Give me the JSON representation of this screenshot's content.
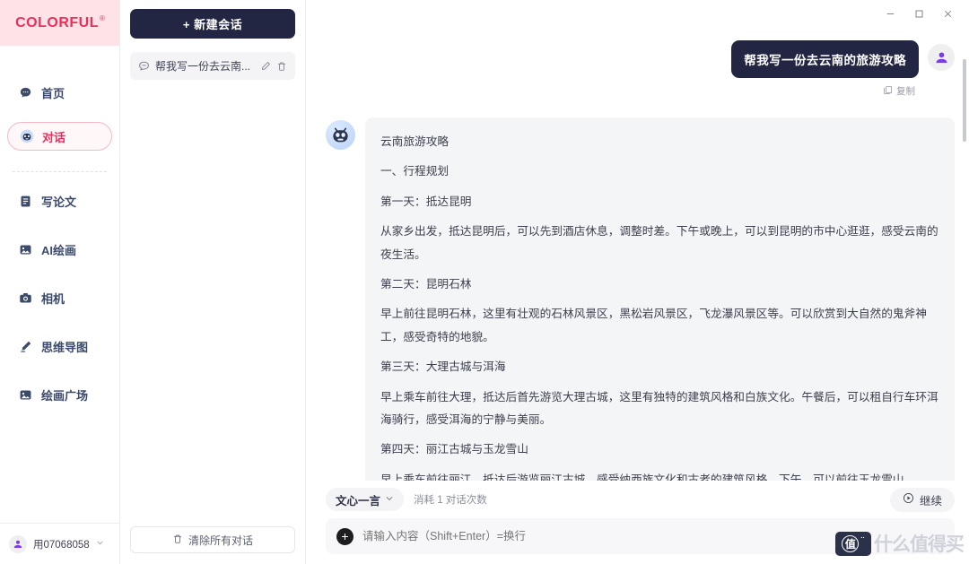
{
  "brand": {
    "name": "COLORFUL",
    "registered": "®"
  },
  "window_controls": {
    "minimize": "—",
    "maximize": "☐",
    "close": "✕"
  },
  "sidebar": {
    "primary_items": [
      {
        "label": "首页",
        "icon": "chat-bubble-icon",
        "active": false
      },
      {
        "label": "对话",
        "icon": "robot-icon",
        "active": true
      }
    ],
    "secondary_items": [
      {
        "label": "写论文",
        "icon": "document-icon"
      },
      {
        "label": "AI绘画",
        "icon": "image-icon"
      },
      {
        "label": "相机",
        "icon": "camera-icon"
      },
      {
        "label": "思维导图",
        "icon": "pen-icon"
      },
      {
        "label": "绘画广场",
        "icon": "gallery-icon"
      }
    ],
    "user": {
      "name": "用07068058",
      "icon": "user-avatar-icon",
      "chevron": "⌄"
    }
  },
  "conversations": {
    "new_chat_label": "+ 新建会话",
    "items": [
      {
        "title": "帮我写一份去云南...",
        "icon": "chat-icon",
        "edit_icon": "pencil-icon",
        "delete_icon": "trash-icon"
      }
    ],
    "clear_all_label": "清除所有对话",
    "clear_all_icon": "trash-icon"
  },
  "chat": {
    "user_message": "帮我写一份去云南的旅游攻略",
    "copy_label": "复制",
    "copy_icon": "copy-icon",
    "bot_paragraphs": [
      "云南旅游攻略",
      "一、行程规划",
      "第一天：抵达昆明",
      "从家乡出发，抵达昆明后，可以先到酒店休息，调整时差。下午或晚上，可以到昆明的市中心逛逛，感受云南的夜生活。",
      "第二天：昆明石林",
      "早上前往昆明石林，这里有壮观的石林风景区，黑松岩风景区，飞龙瀑风景区等。可以欣赏到大自然的鬼斧神工，感受奇特的地貌。",
      "第三天：大理古城与洱海",
      "早上乘车前往大理，抵达后首先游览大理古城，这里有独特的建筑风格和白族文化。午餐后，可以租自行车环洱海骑行，感受洱海的宁静与美丽。",
      "第四天：丽江古城与玉龙雪山",
      "早上乘车前往丽江，抵达后游览丽江古城，感受纳西族文化和古老的建筑风格。下午，可以前往玉龙雪山，"
    ]
  },
  "composer": {
    "model_name": "文心一言",
    "model_chevron": "⌄",
    "quota_text": "消耗 1 对话次数",
    "continue_label": "继续",
    "continue_icon": "play-circle-icon",
    "attach_icon": "plus-icon",
    "input_value": "",
    "input_placeholder": "请输入内容（Shift+Enter）=换行"
  },
  "watermark": {
    "badge": "值",
    "badge_sup": "··",
    "text": "什么值得买"
  },
  "colors": {
    "brand_red": "#e8315a",
    "brand_bg": "#fde3e7",
    "dark_navy": "#232642",
    "bot_bubble": "#f4f5f7",
    "accent_purple": "#7c3aed"
  }
}
